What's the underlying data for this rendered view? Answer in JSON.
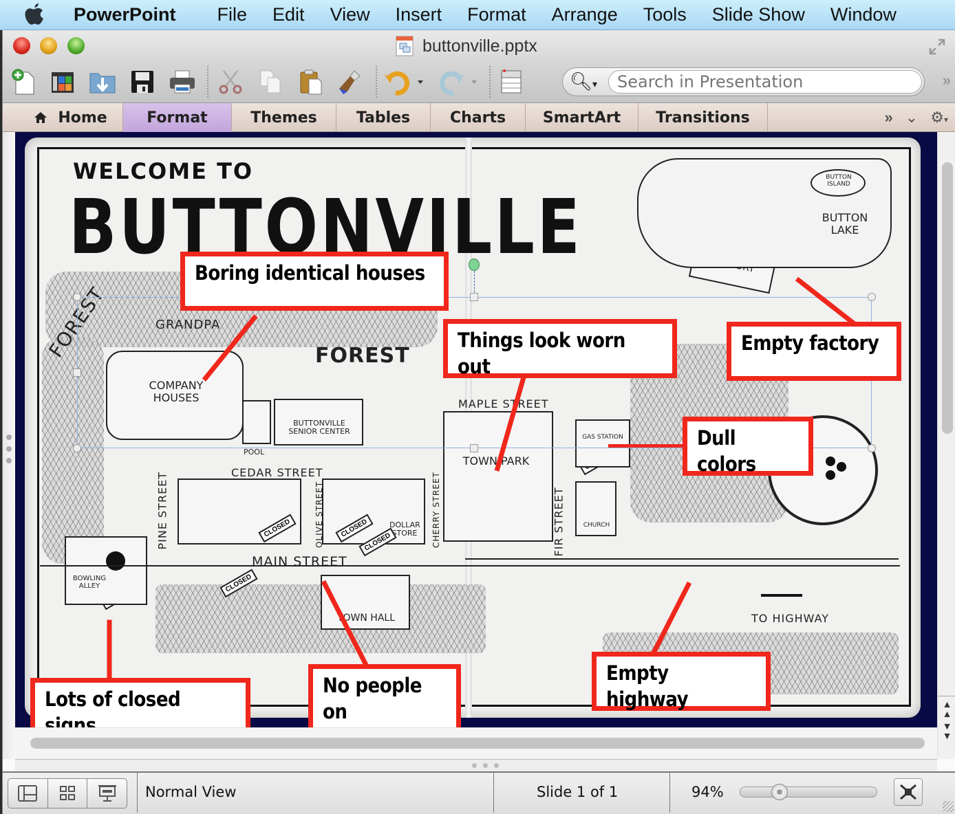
{
  "menubar": {
    "app_name": "PowerPoint",
    "items": [
      "File",
      "Edit",
      "View",
      "Insert",
      "Format",
      "Arrange",
      "Tools",
      "Slide Show",
      "Window"
    ]
  },
  "window": {
    "title": "buttonville.pptx"
  },
  "toolbar": {
    "buttons": [
      "new-presentation",
      "gallery",
      "open",
      "save",
      "print",
      "cut",
      "copy",
      "paste",
      "format-painter",
      "undo",
      "redo",
      "slide-layout"
    ],
    "search_placeholder": "Search in Presentation"
  },
  "ribbon": {
    "tabs": [
      "Home",
      "Format",
      "Themes",
      "Tables",
      "Charts",
      "SmartArt",
      "Transitions"
    ],
    "active_tab": "Format"
  },
  "slide": {
    "map": {
      "welcome": "WELCOME TO",
      "title": "BUTTONVILLE",
      "labels": {
        "forest_left": "FOREST",
        "forest_center": "FOREST",
        "grandpa": "GRANDPA",
        "company_houses": "COMPANY HOUSES",
        "senior_center": "BUTTONVILLE SENIOR CENTER",
        "pool": "POOL",
        "cedar_street": "CEDAR STREET",
        "pine_street": "PINE STREET",
        "olive_street": "OLIVE STREET",
        "cherry_street": "CHERRY STREET",
        "maple_street": "MAPLE STREET",
        "fir_street": "FIR STREET",
        "main_street": "MAIN STREET",
        "town_park": "TOWN PARK",
        "gas_station": "GAS STATION",
        "church": "CHURCH",
        "factory": "BUTTONVILLE BUTTON FACTORY",
        "button_lake": "BUTTON LAKE",
        "button_island": "BUTTON ISLAND",
        "bowling_alley": "BOWLING ALLEY",
        "town_hall": "TOWN HALL",
        "to_highway": "TO HIGHWAY",
        "dollar_store": "DOLLAR STORE",
        "closed": "CLOSED"
      }
    },
    "callouts": [
      {
        "id": "houses",
        "text": "Boring identical houses"
      },
      {
        "id": "worn",
        "text": "Things look worn out"
      },
      {
        "id": "factory",
        "text": "Empty factory"
      },
      {
        "id": "colors",
        "text": "Dull colors"
      },
      {
        "id": "closed",
        "text": "Lots of closed signs"
      },
      {
        "id": "sidewalks",
        "text": "No people on sidewalks"
      },
      {
        "id": "highway",
        "text": "Empty highway"
      }
    ]
  },
  "statusbar": {
    "view_mode": "Normal View",
    "slide_indicator": "Slide 1 of 1",
    "zoom_label": "94%",
    "zoom_percent": 94
  },
  "colors": {
    "callout_red": "#f0271c",
    "slide_background": "#070a45",
    "active_tab": "#c9aee0"
  }
}
